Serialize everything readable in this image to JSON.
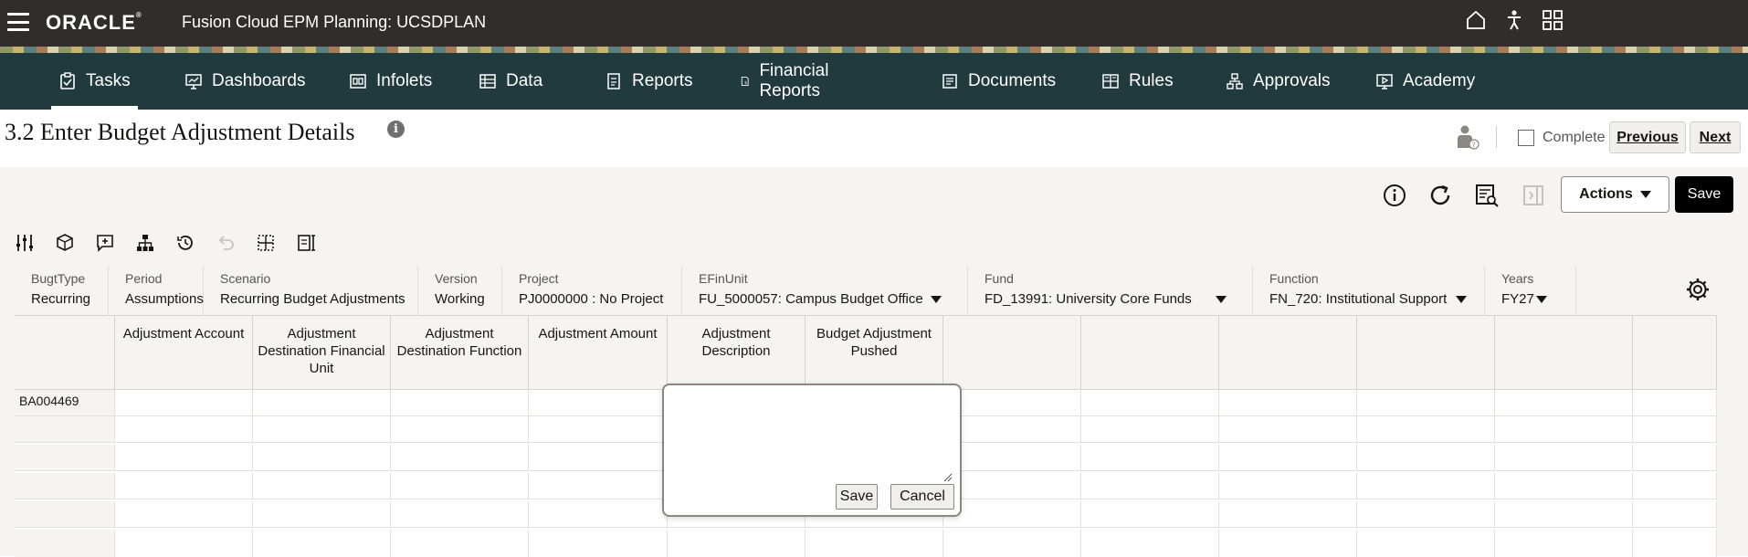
{
  "app": {
    "brand": "ORACLE",
    "title": "Fusion Cloud EPM Planning:  UCSDPLAN"
  },
  "nav": {
    "tabs": [
      {
        "label": "Tasks",
        "icon": "clipboard-check-icon",
        "active": true
      },
      {
        "label": "Dashboards",
        "icon": "monitor-chart-icon"
      },
      {
        "label": "Infolets",
        "icon": "infolets-icon"
      },
      {
        "label": "Data",
        "icon": "data-list-icon"
      },
      {
        "label": "Reports",
        "icon": "reports-icon"
      },
      {
        "label": "Financial Reports",
        "icon": "financial-reports-icon"
      },
      {
        "label": "Documents",
        "icon": "documents-icon"
      },
      {
        "label": "Rules",
        "icon": "rules-icon"
      },
      {
        "label": "Approvals",
        "icon": "approvals-icon"
      },
      {
        "label": "Academy",
        "icon": "academy-icon"
      }
    ]
  },
  "page": {
    "title": "3.2 Enter Budget Adjustment Details",
    "info_glyph": "i",
    "complete_label": "Complete",
    "previous_label": "Previous",
    "next_label": "Next"
  },
  "toolbar": {
    "actions_label": "Actions",
    "save_label": "Save"
  },
  "pov": [
    {
      "label": "BugtType",
      "value": "Recurring"
    },
    {
      "label": "Period",
      "value": "Assumptions"
    },
    {
      "label": "Scenario",
      "value": "Recurring Budget Adjustments"
    },
    {
      "label": "Version",
      "value": "Working"
    },
    {
      "label": "Project",
      "value": "PJ0000000 : No Project"
    },
    {
      "label": "EFinUnit",
      "value": "FU_5000057: Campus Budget Office"
    },
    {
      "label": "Fund",
      "value": "FD_13991: University Core Funds"
    },
    {
      "label": "Function",
      "value": "FN_720: Institutional Support"
    },
    {
      "label": "Years",
      "value": "FY27"
    }
  ],
  "grid": {
    "columns": [
      "Adjustment Account",
      "Adjustment Destination Financial Unit",
      "Adjustment Destination Function",
      "Adjustment Amount",
      "Adjustment Description",
      "Budget Adjustment Pushed"
    ],
    "rows": [
      {
        "header": "BA004469"
      }
    ]
  },
  "popup": {
    "text": "",
    "save_label": "Save",
    "cancel_label": "Cancel"
  },
  "colors": {
    "topbar": "#312d2a",
    "navbar": "#213a3e",
    "save_button": "#000000"
  }
}
